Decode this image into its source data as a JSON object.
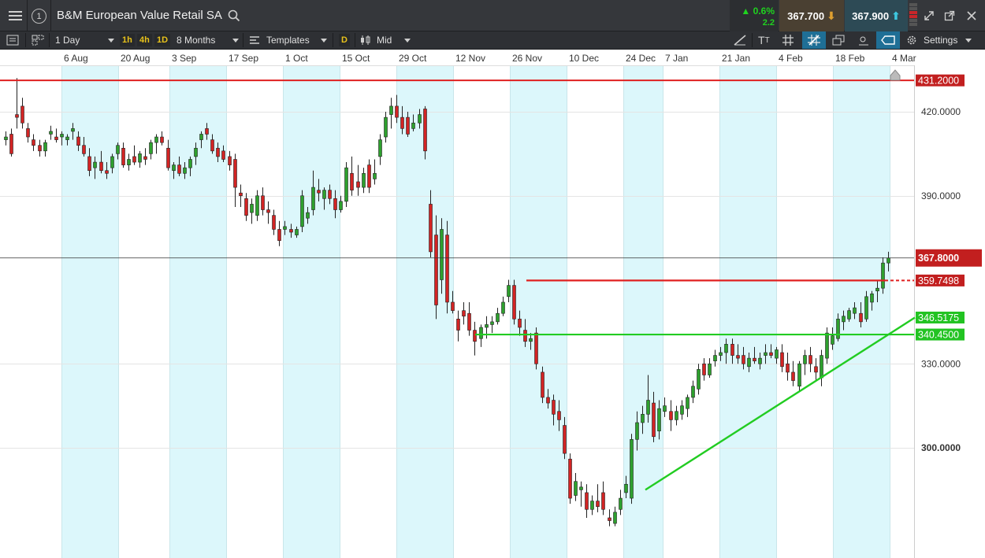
{
  "window": {
    "instrument": "B&M European Value Retail SA",
    "index_badge": "1",
    "change_pct": "0.6%",
    "change_abs": "2.2",
    "sell_price": "367.700",
    "buy_price": "367.900"
  },
  "toolbar": {
    "interval": "1 Day",
    "quick_1h": "1h",
    "quick_4h": "4h",
    "quick_1d": "1D",
    "range": "8 Months",
    "templates": "Templates",
    "d_badge": "D",
    "price_type": "Mid",
    "settings": "Settings"
  },
  "icons": [
    "menu-icon",
    "search-icon",
    "chevron-down-icon",
    "chevron-up-icon",
    "expand-icon",
    "popout-icon",
    "close-icon",
    "list-icon",
    "layout-icon",
    "template-icon",
    "candlestick-icon",
    "draw-line-icon",
    "text-size-icon",
    "grid-icon",
    "crosshair-icon",
    "copy-icon",
    "indicator-icon",
    "label-icon",
    "gear-icon"
  ],
  "colors": {
    "up_candle": "#2ea02e",
    "down_candle": "#d22424",
    "resistance": "#e02020",
    "support": "#22cc22",
    "weekend_band": "#dcf7fb",
    "price_label_bg": "#c21f1f",
    "support_label_bg": "#22c322"
  },
  "chart_data": {
    "type": "candlestick",
    "x_tick_labels": [
      "6 Aug",
      "20 Aug",
      "3 Sep",
      "17 Sep",
      "1 Oct",
      "15 Oct",
      "29 Oct",
      "12 Nov",
      "26 Nov",
      "10 Dec",
      "24 Dec",
      "7 Jan",
      "21 Jan",
      "4 Feb",
      "18 Feb",
      "4 Mar"
    ],
    "y_tick_labels": [
      "420.0000",
      "390.0000",
      "330.0000",
      "300.0000"
    ],
    "y_ticks": [
      420,
      390,
      330,
      300
    ],
    "ylim": [
      262,
      455
    ],
    "last_price": "367.8000",
    "levels": [
      {
        "label": "431.2000",
        "value": 431.2,
        "color": "red"
      },
      {
        "label": "359.7498",
        "value": 359.75,
        "color": "red"
      },
      {
        "label": "346.5175",
        "value": 346.52,
        "color": "green"
      },
      {
        "label": "340.4500",
        "value": 340.45,
        "color": "green"
      }
    ],
    "trendline": {
      "from": [
        "28 Dec",
        285
      ],
      "to": [
        "4 Mar",
        346.5
      ]
    },
    "candles": [
      {
        "o": 410,
        "h": 413,
        "l": 408,
        "c": 411
      },
      {
        "o": 412,
        "h": 414,
        "l": 404,
        "c": 405
      },
      {
        "o": 419,
        "h": 432,
        "l": 414,
        "c": 418
      },
      {
        "o": 422,
        "h": 425,
        "l": 414,
        "c": 416
      },
      {
        "o": 414,
        "h": 416,
        "l": 409,
        "c": 411
      },
      {
        "o": 410,
        "h": 412,
        "l": 406,
        "c": 408
      },
      {
        "o": 408,
        "h": 410,
        "l": 404,
        "c": 406
      },
      {
        "o": 406,
        "h": 410,
        "l": 404,
        "c": 409
      },
      {
        "o": 412,
        "h": 415,
        "l": 410,
        "c": 413
      },
      {
        "o": 411,
        "h": 414,
        "l": 409,
        "c": 410
      },
      {
        "o": 411,
        "h": 413,
        "l": 408,
        "c": 412
      },
      {
        "o": 410,
        "h": 412,
        "l": 408,
        "c": 411
      },
      {
        "o": 413,
        "h": 416,
        "l": 410,
        "c": 414
      },
      {
        "o": 411,
        "h": 413,
        "l": 406,
        "c": 408
      },
      {
        "o": 408,
        "h": 411,
        "l": 404,
        "c": 405
      },
      {
        "o": 404,
        "h": 407,
        "l": 397,
        "c": 399
      },
      {
        "o": 400,
        "h": 404,
        "l": 396,
        "c": 402
      },
      {
        "o": 402,
        "h": 406,
        "l": 398,
        "c": 399
      },
      {
        "o": 399,
        "h": 402,
        "l": 396,
        "c": 398
      },
      {
        "o": 400,
        "h": 405,
        "l": 398,
        "c": 404
      },
      {
        "o": 405,
        "h": 409,
        "l": 403,
        "c": 408
      },
      {
        "o": 407,
        "h": 409,
        "l": 400,
        "c": 401
      },
      {
        "o": 401,
        "h": 405,
        "l": 399,
        "c": 403
      },
      {
        "o": 404,
        "h": 408,
        "l": 401,
        "c": 402
      },
      {
        "o": 402,
        "h": 406,
        "l": 400,
        "c": 405
      },
      {
        "o": 404,
        "h": 407,
        "l": 401,
        "c": 403
      },
      {
        "o": 405,
        "h": 410,
        "l": 403,
        "c": 409
      },
      {
        "o": 409,
        "h": 412,
        "l": 405,
        "c": 411
      },
      {
        "o": 411,
        "h": 413,
        "l": 408,
        "c": 409
      },
      {
        "o": 407,
        "h": 410,
        "l": 399,
        "c": 400
      },
      {
        "o": 399,
        "h": 402,
        "l": 396,
        "c": 401
      },
      {
        "o": 401,
        "h": 404,
        "l": 397,
        "c": 398
      },
      {
        "o": 398,
        "h": 402,
        "l": 396,
        "c": 400
      },
      {
        "o": 400,
        "h": 404,
        "l": 397,
        "c": 403
      },
      {
        "o": 404,
        "h": 409,
        "l": 401,
        "c": 407
      },
      {
        "o": 410,
        "h": 413,
        "l": 407,
        "c": 412
      },
      {
        "o": 414,
        "h": 416,
        "l": 410,
        "c": 412
      },
      {
        "o": 410,
        "h": 412,
        "l": 405,
        "c": 406
      },
      {
        "o": 407,
        "h": 409,
        "l": 402,
        "c": 404
      },
      {
        "o": 406,
        "h": 408,
        "l": 402,
        "c": 403
      },
      {
        "o": 404,
        "h": 406,
        "l": 399,
        "c": 401
      },
      {
        "o": 403,
        "h": 405,
        "l": 386,
        "c": 393
      },
      {
        "o": 391,
        "h": 394,
        "l": 386,
        "c": 390
      },
      {
        "o": 389,
        "h": 391,
        "l": 381,
        "c": 383
      },
      {
        "o": 384,
        "h": 389,
        "l": 380,
        "c": 387
      },
      {
        "o": 383,
        "h": 392,
        "l": 381,
        "c": 390
      },
      {
        "o": 390,
        "h": 393,
        "l": 383,
        "c": 385
      },
      {
        "o": 385,
        "h": 388,
        "l": 380,
        "c": 384
      },
      {
        "o": 383,
        "h": 385,
        "l": 376,
        "c": 378
      },
      {
        "o": 378,
        "h": 381,
        "l": 372,
        "c": 374
      },
      {
        "o": 378,
        "h": 381,
        "l": 376,
        "c": 379
      },
      {
        "o": 378,
        "h": 380,
        "l": 375,
        "c": 377
      },
      {
        "o": 376,
        "h": 379,
        "l": 375,
        "c": 378
      },
      {
        "o": 379,
        "h": 392,
        "l": 377,
        "c": 390
      },
      {
        "o": 382,
        "h": 386,
        "l": 380,
        "c": 384
      },
      {
        "o": 385,
        "h": 399,
        "l": 383,
        "c": 393
      },
      {
        "o": 392,
        "h": 396,
        "l": 388,
        "c": 391
      },
      {
        "o": 389,
        "h": 393,
        "l": 385,
        "c": 392
      },
      {
        "o": 392,
        "h": 394,
        "l": 387,
        "c": 389
      },
      {
        "o": 389,
        "h": 392,
        "l": 382,
        "c": 385
      },
      {
        "o": 385,
        "h": 390,
        "l": 384,
        "c": 388
      },
      {
        "o": 388,
        "h": 402,
        "l": 386,
        "c": 400
      },
      {
        "o": 398,
        "h": 404,
        "l": 390,
        "c": 392
      },
      {
        "o": 395,
        "h": 401,
        "l": 390,
        "c": 393
      },
      {
        "o": 393,
        "h": 400,
        "l": 391,
        "c": 398
      },
      {
        "o": 401,
        "h": 403,
        "l": 391,
        "c": 393
      },
      {
        "o": 396,
        "h": 403,
        "l": 394,
        "c": 398
      },
      {
        "o": 404,
        "h": 412,
        "l": 401,
        "c": 410
      },
      {
        "o": 411,
        "h": 420,
        "l": 409,
        "c": 418
      },
      {
        "o": 419,
        "h": 425,
        "l": 414,
        "c": 422
      },
      {
        "o": 422,
        "h": 426,
        "l": 416,
        "c": 418
      },
      {
        "o": 418,
        "h": 422,
        "l": 412,
        "c": 414
      },
      {
        "o": 418,
        "h": 420,
        "l": 411,
        "c": 412
      },
      {
        "o": 414,
        "h": 419,
        "l": 413,
        "c": 416
      },
      {
        "o": 416,
        "h": 421,
        "l": 414,
        "c": 419
      },
      {
        "o": 421,
        "h": 422,
        "l": 403,
        "c": 406
      },
      {
        "o": 387,
        "h": 392,
        "l": 368,
        "c": 370
      },
      {
        "o": 376,
        "h": 383,
        "l": 346,
        "c": 351
      },
      {
        "o": 360,
        "h": 382,
        "l": 355,
        "c": 378
      },
      {
        "o": 376,
        "h": 381,
        "l": 348,
        "c": 352
      },
      {
        "o": 352,
        "h": 356,
        "l": 348,
        "c": 349
      },
      {
        "o": 346,
        "h": 349,
        "l": 338,
        "c": 342
      },
      {
        "o": 349,
        "h": 352,
        "l": 344,
        "c": 347
      },
      {
        "o": 348,
        "h": 352,
        "l": 340,
        "c": 342
      },
      {
        "o": 342,
        "h": 345,
        "l": 333,
        "c": 338
      },
      {
        "o": 339,
        "h": 344,
        "l": 336,
        "c": 343
      },
      {
        "o": 343,
        "h": 347,
        "l": 339,
        "c": 344
      },
      {
        "o": 344,
        "h": 347,
        "l": 341,
        "c": 345
      },
      {
        "o": 345,
        "h": 350,
        "l": 344,
        "c": 348
      },
      {
        "o": 348,
        "h": 354,
        "l": 347,
        "c": 352
      },
      {
        "o": 354,
        "h": 360,
        "l": 352,
        "c": 358
      },
      {
        "o": 358,
        "h": 360,
        "l": 344,
        "c": 346
      },
      {
        "o": 346,
        "h": 349,
        "l": 340,
        "c": 343
      },
      {
        "o": 342,
        "h": 346,
        "l": 336,
        "c": 338
      },
      {
        "o": 338,
        "h": 341,
        "l": 335,
        "c": 339
      },
      {
        "o": 341,
        "h": 343,
        "l": 328,
        "c": 330
      },
      {
        "o": 327,
        "h": 329,
        "l": 316,
        "c": 318
      },
      {
        "o": 318,
        "h": 321,
        "l": 314,
        "c": 316
      },
      {
        "o": 317,
        "h": 319,
        "l": 308,
        "c": 312
      },
      {
        "o": 313,
        "h": 317,
        "l": 306,
        "c": 310
      },
      {
        "o": 308,
        "h": 311,
        "l": 296,
        "c": 298
      },
      {
        "o": 296,
        "h": 298,
        "l": 280,
        "c": 282
      },
      {
        "o": 283,
        "h": 291,
        "l": 281,
        "c": 288
      },
      {
        "o": 285,
        "h": 288,
        "l": 279,
        "c": 286
      },
      {
        "o": 284,
        "h": 287,
        "l": 275,
        "c": 278
      },
      {
        "o": 278,
        "h": 283,
        "l": 276,
        "c": 281
      },
      {
        "o": 281,
        "h": 287,
        "l": 277,
        "c": 279
      },
      {
        "o": 284,
        "h": 288,
        "l": 276,
        "c": 278
      },
      {
        "o": 275,
        "h": 278,
        "l": 272,
        "c": 274
      },
      {
        "o": 273,
        "h": 279,
        "l": 272,
        "c": 277
      },
      {
        "o": 278,
        "h": 285,
        "l": 276,
        "c": 282
      },
      {
        "o": 284,
        "h": 290,
        "l": 282,
        "c": 287
      },
      {
        "o": 282,
        "h": 305,
        "l": 280,
        "c": 303
      },
      {
        "o": 303,
        "h": 313,
        "l": 299,
        "c": 309
      },
      {
        "o": 309,
        "h": 315,
        "l": 305,
        "c": 312
      },
      {
        "o": 312,
        "h": 326,
        "l": 309,
        "c": 317
      },
      {
        "o": 316,
        "h": 320,
        "l": 302,
        "c": 304
      },
      {
        "o": 306,
        "h": 317,
        "l": 303,
        "c": 314
      },
      {
        "o": 313,
        "h": 318,
        "l": 311,
        "c": 315
      },
      {
        "o": 313,
        "h": 317,
        "l": 306,
        "c": 310
      },
      {
        "o": 310,
        "h": 315,
        "l": 308,
        "c": 313
      },
      {
        "o": 312,
        "h": 317,
        "l": 310,
        "c": 315
      },
      {
        "o": 314,
        "h": 319,
        "l": 311,
        "c": 318
      },
      {
        "o": 318,
        "h": 324,
        "l": 316,
        "c": 322
      },
      {
        "o": 321,
        "h": 330,
        "l": 319,
        "c": 328
      },
      {
        "o": 330,
        "h": 332,
        "l": 324,
        "c": 326
      },
      {
        "o": 326,
        "h": 332,
        "l": 325,
        "c": 330
      },
      {
        "o": 331,
        "h": 335,
        "l": 329,
        "c": 333
      },
      {
        "o": 333,
        "h": 336,
        "l": 331,
        "c": 334
      },
      {
        "o": 334,
        "h": 339,
        "l": 330,
        "c": 337
      },
      {
        "o": 337,
        "h": 339,
        "l": 330,
        "c": 333
      },
      {
        "o": 333,
        "h": 337,
        "l": 330,
        "c": 332
      },
      {
        "o": 333,
        "h": 336,
        "l": 328,
        "c": 330
      },
      {
        "o": 329,
        "h": 334,
        "l": 327,
        "c": 332
      },
      {
        "o": 332,
        "h": 336,
        "l": 330,
        "c": 331
      },
      {
        "o": 330,
        "h": 334,
        "l": 328,
        "c": 332
      },
      {
        "o": 333,
        "h": 337,
        "l": 330,
        "c": 334
      },
      {
        "o": 334,
        "h": 337,
        "l": 332,
        "c": 333
      },
      {
        "o": 332,
        "h": 336,
        "l": 330,
        "c": 335
      },
      {
        "o": 334,
        "h": 337,
        "l": 327,
        "c": 329
      },
      {
        "o": 330,
        "h": 334,
        "l": 324,
        "c": 327
      },
      {
        "o": 327,
        "h": 331,
        "l": 322,
        "c": 324
      },
      {
        "o": 322,
        "h": 331,
        "l": 320,
        "c": 330
      },
      {
        "o": 330,
        "h": 335,
        "l": 326,
        "c": 333
      },
      {
        "o": 333,
        "h": 336,
        "l": 327,
        "c": 330
      },
      {
        "o": 329,
        "h": 332,
        "l": 324,
        "c": 327
      },
      {
        "o": 325,
        "h": 335,
        "l": 322,
        "c": 333
      },
      {
        "o": 332,
        "h": 343,
        "l": 330,
        "c": 341
      },
      {
        "o": 337,
        "h": 343,
        "l": 335,
        "c": 340
      },
      {
        "o": 339,
        "h": 348,
        "l": 338,
        "c": 346
      },
      {
        "o": 345,
        "h": 349,
        "l": 342,
        "c": 347
      },
      {
        "o": 346,
        "h": 350,
        "l": 345,
        "c": 349
      },
      {
        "o": 348,
        "h": 352,
        "l": 346,
        "c": 350
      },
      {
        "o": 348,
        "h": 352,
        "l": 343,
        "c": 345
      },
      {
        "o": 346,
        "h": 356,
        "l": 345,
        "c": 354
      },
      {
        "o": 352,
        "h": 356,
        "l": 349,
        "c": 355
      },
      {
        "o": 356,
        "h": 360,
        "l": 352,
        "c": 357
      },
      {
        "o": 357,
        "h": 368,
        "l": 355,
        "c": 366
      },
      {
        "o": 366,
        "h": 370,
        "l": 363,
        "c": 367.8
      }
    ]
  }
}
